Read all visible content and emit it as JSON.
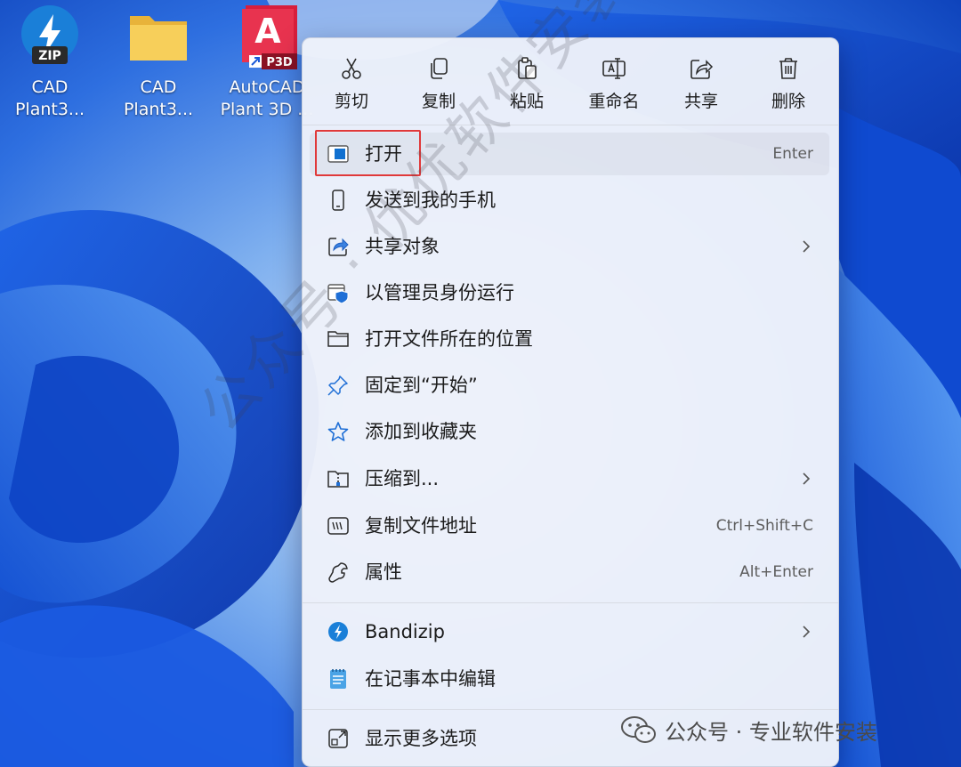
{
  "desktop": {
    "icons": [
      {
        "line1": "CAD",
        "line2": "Plant3...",
        "badge": "ZIP",
        "icon": "bandizip-archive-icon",
        "color": "#1a7fd8"
      },
      {
        "line1": "CAD",
        "line2": "Plant3...",
        "icon": "folder-icon",
        "color": "#f5c542"
      },
      {
        "line1": "AutoCAD",
        "line2": "Plant 3D ...",
        "badge": "P3D",
        "letter": "A",
        "icon": "autocad-plant3d-icon",
        "color": "#d81e3c"
      }
    ]
  },
  "context_menu": {
    "toolbar": [
      {
        "label": "剪切",
        "icon": "scissors-icon"
      },
      {
        "label": "复制",
        "icon": "copy-icon"
      },
      {
        "label": "粘贴",
        "icon": "paste-icon"
      },
      {
        "label": "重命名",
        "icon": "rename-icon"
      },
      {
        "label": "共享",
        "icon": "share-icon"
      },
      {
        "label": "删除",
        "icon": "trash-icon"
      }
    ],
    "items": [
      {
        "label": "打开",
        "shortcut": "Enter",
        "icon": "open-window-icon",
        "hover": true
      },
      {
        "label": "发送到我的手机",
        "icon": "phone-icon"
      },
      {
        "label": "共享对象",
        "icon": "share-icon",
        "submenu": true
      },
      {
        "label": "以管理员身份运行",
        "icon": "admin-shield-icon"
      },
      {
        "label": "打开文件所在的位置",
        "icon": "folder-outline-icon"
      },
      {
        "label": "固定到“开始”",
        "icon": "pin-icon"
      },
      {
        "label": "添加到收藏夹",
        "icon": "star-icon"
      },
      {
        "label": "压缩到...",
        "icon": "zip-folder-icon",
        "submenu": true
      },
      {
        "label": "复制文件地址",
        "shortcut": "Ctrl+Shift+C",
        "icon": "path-icon"
      },
      {
        "label": "属性",
        "shortcut": "Alt+Enter",
        "icon": "wrench-icon"
      },
      {
        "label": "Bandizip",
        "icon": "bandizip-icon",
        "submenu": true
      },
      {
        "label": "在记事本中编辑",
        "icon": "notepad-icon"
      },
      {
        "label": "显示更多选项",
        "icon": "more-options-icon"
      }
    ]
  },
  "watermark": "公众号 · 优优软件安装",
  "footer_credit": "公众号 · 专业软件安装",
  "colors": {
    "highlight_border": "#e0393a",
    "accent": "#0f6cbd"
  }
}
